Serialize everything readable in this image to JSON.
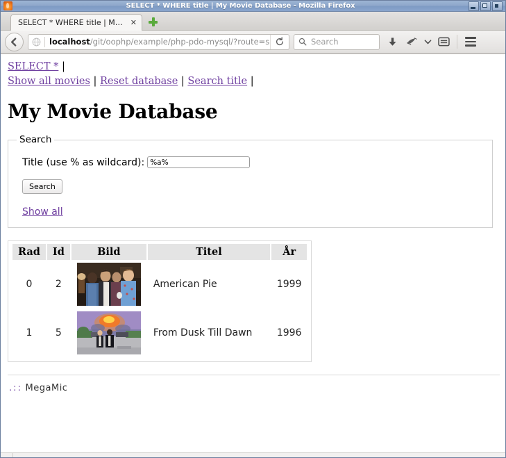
{
  "window": {
    "title": "SELECT * WHERE title | My Movie Database - Mozilla Firefox",
    "app_icon": "firefox-icon",
    "buttons": {
      "minimize": "minimize-button",
      "maximize": "maximize-button",
      "close": "close-button"
    }
  },
  "browser": {
    "tab": {
      "label": "SELECT * WHERE title | My M...",
      "close_label": "✕"
    },
    "new_tab_label": "+",
    "back_button": "back-button",
    "url": {
      "host": "localhost",
      "path": "/git/oophp/example/php-pdo-mysql/?route=search-title",
      "full": "localhost/git/oophp/example/php-pdo-mysql/?route=search-title"
    },
    "reload_label": "reload",
    "search": {
      "placeholder": "Search"
    },
    "toolbar_icons": [
      "download-arrow-icon",
      "pocket-icon",
      "chevron-down-icon",
      "reader-view-icon",
      "hamburger-menu-icon"
    ]
  },
  "page": {
    "nav": {
      "line1": [
        {
          "label": "SELECT *",
          "type": "link"
        },
        {
          "label": "|",
          "type": "separator"
        }
      ],
      "line2": [
        {
          "label": "Show all movies",
          "type": "link"
        },
        {
          "label": "|",
          "type": "separator"
        },
        {
          "label": "Reset database",
          "type": "link"
        },
        {
          "label": "|",
          "type": "separator"
        },
        {
          "label": "Search title",
          "type": "link"
        },
        {
          "label": "|",
          "type": "separator"
        }
      ]
    },
    "heading": "My Movie Database",
    "search_form": {
      "legend": "Search",
      "field_label": "Title (use % as wildcard):",
      "field_value": "%a%",
      "field_placeholder": "",
      "submit_label": "Search",
      "show_all_label": "Show all"
    },
    "results_table": {
      "headers": [
        "Rad",
        "Id",
        "Bild",
        "Titel",
        "År"
      ],
      "rows": [
        {
          "rad": "0",
          "id": "2",
          "bild_alt": "american-pie-thumbnail",
          "titel": "American Pie",
          "ar": "1999"
        },
        {
          "rad": "1",
          "id": "5",
          "bild_alt": "from-dusk-till-dawn-thumbnail",
          "titel": "From Dusk Till Dawn",
          "ar": "1996"
        }
      ]
    },
    "footer": {
      "dots": ".::",
      "text": "MegaMic"
    }
  },
  "colors": {
    "link": "#6f3fa0",
    "titlebar": "#8fa8cb",
    "table_header_bg": "#e4e4e4",
    "page_bg": "#ffffff"
  }
}
